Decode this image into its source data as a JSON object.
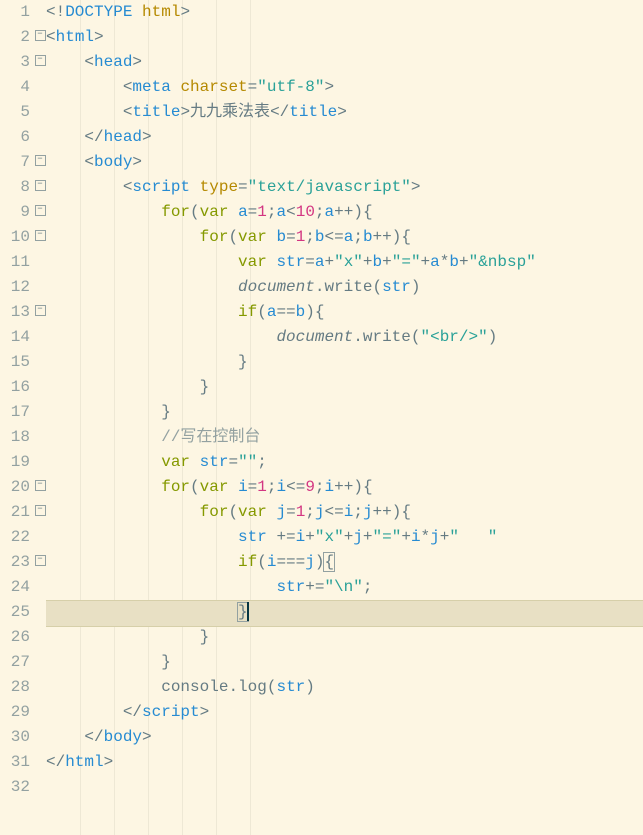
{
  "lineCount": 32,
  "foldable": [
    2,
    3,
    7,
    8,
    9,
    10,
    13,
    20,
    21,
    23
  ],
  "highlightLine": 25,
  "cursorLine": 25,
  "lines": {
    "1": [
      [
        "pu",
        "<!"
      ],
      [
        "tag",
        "DOCTYPE"
      ],
      [
        "pu",
        " "
      ],
      [
        "attr",
        "html"
      ],
      [
        "pu",
        ">"
      ]
    ],
    "2": [
      [
        "pu",
        "<"
      ],
      [
        "tag",
        "html"
      ],
      [
        "pu",
        ">"
      ]
    ],
    "3": [
      [
        "ws",
        "    "
      ],
      [
        "pu",
        "<"
      ],
      [
        "tag",
        "head"
      ],
      [
        "pu",
        ">"
      ]
    ],
    "4": [
      [
        "ws",
        "        "
      ],
      [
        "pu",
        "<"
      ],
      [
        "tag",
        "meta"
      ],
      [
        "pu",
        " "
      ],
      [
        "attr",
        "charset"
      ],
      [
        "pu",
        "="
      ],
      [
        "str",
        "\"utf-8\""
      ],
      [
        "pu",
        ">"
      ]
    ],
    "5": [
      [
        "ws",
        "        "
      ],
      [
        "pu",
        "<"
      ],
      [
        "tag",
        "title"
      ],
      [
        "pu",
        ">"
      ],
      [
        "txt",
        "九九乘法表"
      ],
      [
        "pu",
        "</"
      ],
      [
        "tag",
        "title"
      ],
      [
        "pu",
        ">"
      ]
    ],
    "6": [
      [
        "ws",
        "    "
      ],
      [
        "pu",
        "</"
      ],
      [
        "tag",
        "head"
      ],
      [
        "pu",
        ">"
      ]
    ],
    "7": [
      [
        "ws",
        "    "
      ],
      [
        "pu",
        "<"
      ],
      [
        "tag",
        "body"
      ],
      [
        "pu",
        ">"
      ]
    ],
    "8": [
      [
        "ws",
        "        "
      ],
      [
        "pu",
        "<"
      ],
      [
        "tag",
        "script"
      ],
      [
        "pu",
        " "
      ],
      [
        "attr",
        "type"
      ],
      [
        "pu",
        "="
      ],
      [
        "str",
        "\"text/javascript\""
      ],
      [
        "pu",
        ">"
      ]
    ],
    "9": [
      [
        "ws",
        "            "
      ],
      [
        "kw",
        "for"
      ],
      [
        "op",
        "("
      ],
      [
        "kw",
        "var"
      ],
      [
        "op",
        " "
      ],
      [
        "var",
        "a"
      ],
      [
        "op",
        "="
      ],
      [
        "num",
        "1"
      ],
      [
        "op",
        ";"
      ],
      [
        "var",
        "a"
      ],
      [
        "op",
        "<"
      ],
      [
        "num",
        "10"
      ],
      [
        "op",
        ";"
      ],
      [
        "var",
        "a"
      ],
      [
        "op",
        "++){"
      ]
    ],
    "10": [
      [
        "ws",
        "                "
      ],
      [
        "kw",
        "for"
      ],
      [
        "op",
        "("
      ],
      [
        "kw",
        "var"
      ],
      [
        "op",
        " "
      ],
      [
        "var",
        "b"
      ],
      [
        "op",
        "="
      ],
      [
        "num",
        "1"
      ],
      [
        "op",
        ";"
      ],
      [
        "var",
        "b"
      ],
      [
        "op",
        "<="
      ],
      [
        "var",
        "a"
      ],
      [
        "op",
        ";"
      ],
      [
        "var",
        "b"
      ],
      [
        "op",
        "++){"
      ]
    ],
    "11": [
      [
        "ws",
        "                    "
      ],
      [
        "kw",
        "var"
      ],
      [
        "op",
        " "
      ],
      [
        "var",
        "str"
      ],
      [
        "op",
        "="
      ],
      [
        "var",
        "a"
      ],
      [
        "op",
        "+"
      ],
      [
        "str",
        "\"x\""
      ],
      [
        "op",
        "+"
      ],
      [
        "var",
        "b"
      ],
      [
        "op",
        "+"
      ],
      [
        "str",
        "\"=\""
      ],
      [
        "op",
        "+"
      ],
      [
        "var",
        "a"
      ],
      [
        "op",
        "*"
      ],
      [
        "var",
        "b"
      ],
      [
        "op",
        "+"
      ],
      [
        "str",
        "\"&nbsp\""
      ]
    ],
    "12": [
      [
        "ws",
        "                    "
      ],
      [
        "obj",
        "document"
      ],
      [
        "op",
        "."
      ],
      [
        "fn",
        "write"
      ],
      [
        "op",
        "("
      ],
      [
        "var",
        "str"
      ],
      [
        "op",
        ")"
      ]
    ],
    "13": [
      [
        "ws",
        "                    "
      ],
      [
        "kw",
        "if"
      ],
      [
        "op",
        "("
      ],
      [
        "var",
        "a"
      ],
      [
        "op",
        "=="
      ],
      [
        "var",
        "b"
      ],
      [
        "op",
        "){"
      ]
    ],
    "14": [
      [
        "ws",
        "                        "
      ],
      [
        "obj",
        "document"
      ],
      [
        "op",
        "."
      ],
      [
        "fn",
        "write"
      ],
      [
        "op",
        "("
      ],
      [
        "str",
        "\"<br/>\""
      ],
      [
        "op",
        ")"
      ]
    ],
    "15": [
      [
        "ws",
        "                    "
      ],
      [
        "op",
        "}"
      ]
    ],
    "16": [
      [
        "ws",
        "                "
      ],
      [
        "op",
        "}"
      ]
    ],
    "17": [
      [
        "ws",
        "            "
      ],
      [
        "op",
        "}"
      ]
    ],
    "18": [
      [
        "ws",
        "            "
      ],
      [
        "cmt",
        "//写在控制台"
      ]
    ],
    "19": [
      [
        "ws",
        "            "
      ],
      [
        "kw",
        "var"
      ],
      [
        "op",
        " "
      ],
      [
        "var",
        "str"
      ],
      [
        "op",
        "="
      ],
      [
        "str",
        "\"\""
      ],
      [
        "op",
        ";"
      ]
    ],
    "20": [
      [
        "ws",
        "            "
      ],
      [
        "kw",
        "for"
      ],
      [
        "op",
        "("
      ],
      [
        "kw",
        "var"
      ],
      [
        "op",
        " "
      ],
      [
        "var",
        "i"
      ],
      [
        "op",
        "="
      ],
      [
        "num",
        "1"
      ],
      [
        "op",
        ";"
      ],
      [
        "var",
        "i"
      ],
      [
        "op",
        "<="
      ],
      [
        "num",
        "9"
      ],
      [
        "op",
        ";"
      ],
      [
        "var",
        "i"
      ],
      [
        "op",
        "++){"
      ]
    ],
    "21": [
      [
        "ws",
        "                "
      ],
      [
        "kw",
        "for"
      ],
      [
        "op",
        "("
      ],
      [
        "kw",
        "var"
      ],
      [
        "op",
        " "
      ],
      [
        "var",
        "j"
      ],
      [
        "op",
        "="
      ],
      [
        "num",
        "1"
      ],
      [
        "op",
        ";"
      ],
      [
        "var",
        "j"
      ],
      [
        "op",
        "<="
      ],
      [
        "var",
        "i"
      ],
      [
        "op",
        ";"
      ],
      [
        "var",
        "j"
      ],
      [
        "op",
        "++){"
      ]
    ],
    "22": [
      [
        "ws",
        "                    "
      ],
      [
        "var",
        "str"
      ],
      [
        "op",
        " +="
      ],
      [
        "var",
        "i"
      ],
      [
        "op",
        "+"
      ],
      [
        "str",
        "\"x\""
      ],
      [
        "op",
        "+"
      ],
      [
        "var",
        "j"
      ],
      [
        "op",
        "+"
      ],
      [
        "str",
        "\"=\""
      ],
      [
        "op",
        "+"
      ],
      [
        "var",
        "i"
      ],
      [
        "op",
        "*"
      ],
      [
        "var",
        "j"
      ],
      [
        "op",
        "+"
      ],
      [
        "str",
        "\"   \""
      ]
    ],
    "23": [
      [
        "ws",
        "                    "
      ],
      [
        "kw",
        "if"
      ],
      [
        "op",
        "("
      ],
      [
        "var",
        "i"
      ],
      [
        "op",
        "==="
      ],
      [
        "var",
        "j"
      ],
      [
        "op",
        ")"
      ],
      [
        "opMatch",
        "{"
      ]
    ],
    "24": [
      [
        "ws",
        "                        "
      ],
      [
        "var",
        "str"
      ],
      [
        "op",
        "+="
      ],
      [
        "str",
        "\"\\n\""
      ],
      [
        "op",
        ";"
      ]
    ],
    "25": [
      [
        "ws",
        "                    "
      ],
      [
        "opMatch",
        "}"
      ]
    ],
    "26": [
      [
        "ws",
        "                "
      ],
      [
        "op",
        "}"
      ]
    ],
    "27": [
      [
        "ws",
        "            "
      ],
      [
        "op",
        "}"
      ]
    ],
    "28": [
      [
        "ws",
        "            "
      ],
      [
        "fn",
        "console"
      ],
      [
        "op",
        "."
      ],
      [
        "fn",
        "log"
      ],
      [
        "op",
        "("
      ],
      [
        "var",
        "str"
      ],
      [
        "op",
        ")"
      ]
    ],
    "29": [
      [
        "ws",
        "        "
      ],
      [
        "pu",
        "</"
      ],
      [
        "tag",
        "script"
      ],
      [
        "pu",
        ">"
      ]
    ],
    "30": [
      [
        "ws",
        "    "
      ],
      [
        "pu",
        "</"
      ],
      [
        "tag",
        "body"
      ],
      [
        "pu",
        ">"
      ]
    ],
    "31": [
      [
        "pu",
        "</"
      ],
      [
        "tag",
        "html"
      ],
      [
        "pu",
        ">"
      ]
    ],
    "32": [
      [
        "ws",
        ""
      ]
    ]
  }
}
